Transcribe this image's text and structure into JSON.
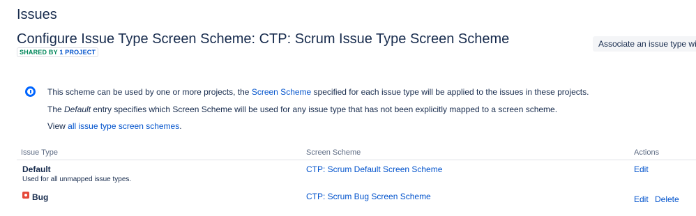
{
  "page": {
    "heading": "Issues",
    "scheme_title": "Configure Issue Type Screen Scheme: CTP: Scrum Issue Type Screen Scheme",
    "badge": {
      "shared_by": "SHARED BY",
      "project_link": "1 PROJECT"
    },
    "associate_button": "Associate an issue type with a"
  },
  "info": {
    "icon": "info-icon",
    "line1_before": "This scheme can be used by one or more projects, the ",
    "line1_link": "Screen Scheme",
    "line1_after": " specified for each issue type will be applied to the issues in these projects.",
    "line2_before": "The ",
    "line2_em": "Default",
    "line2_after": " entry specifies which Screen Scheme will be used for any issue type that has not been explicitly mapped to a screen scheme.",
    "line3_before": "View ",
    "line3_link": "all issue type screen schemes",
    "line3_after": "."
  },
  "table": {
    "columns": {
      "issue_type": "Issue Type",
      "screen_scheme": "Screen Scheme",
      "actions": "Actions"
    },
    "rows": [
      {
        "issue_type": "Default",
        "description": "Used for all unmapped issue types.",
        "screen_scheme": "CTP: Scrum Default Screen Scheme",
        "actions": [
          "Edit"
        ]
      },
      {
        "issue_type": "Bug",
        "icon": "bug-icon",
        "icon_color": "#e5493a",
        "screen_scheme": "CTP: Scrum Bug Screen Scheme",
        "actions": [
          "Edit",
          "Delete"
        ]
      }
    ]
  },
  "colors": {
    "link": "#0052cc",
    "text": "#172b4d",
    "shared": "#00875a"
  }
}
